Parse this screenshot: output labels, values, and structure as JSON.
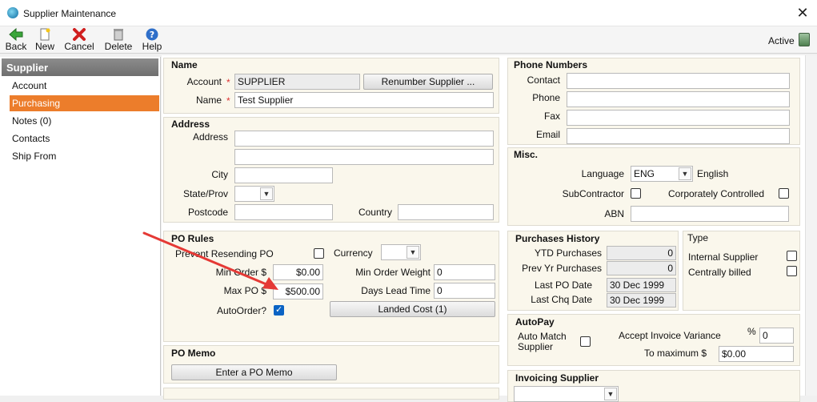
{
  "window": {
    "title": "Supplier Maintenance",
    "close_glyph": "✕"
  },
  "toolbar": {
    "back": "Back",
    "new": "New",
    "cancel": "Cancel",
    "delete": "Delete",
    "help": "Help",
    "status": "Active"
  },
  "sidebar": {
    "header": "Supplier",
    "items": [
      {
        "label": "Account"
      },
      {
        "label": "Purchasing"
      },
      {
        "label": "Notes (0)"
      },
      {
        "label": "Contacts"
      },
      {
        "label": "Ship From"
      }
    ]
  },
  "name_group": {
    "title": "Name",
    "account_label": "Account",
    "account_value": "SUPPLIER",
    "renumber_button": "Renumber Supplier ...",
    "name_label": "Name",
    "name_value": "Test Supplier",
    "required_mark": "*"
  },
  "address_group": {
    "title": "Address",
    "address_label": "Address",
    "address1": "",
    "address2": "",
    "city_label": "City",
    "city": "",
    "state_label": "State/Prov",
    "state": "",
    "postcode_label": "Postcode",
    "postcode": "",
    "country_label": "Country",
    "country": ""
  },
  "phone_group": {
    "title": "Phone Numbers",
    "contact_label": "Contact",
    "contact": "",
    "phone_label": "Phone",
    "phone": "",
    "fax_label": "Fax",
    "fax": "",
    "email_label": "Email",
    "email": ""
  },
  "misc_group": {
    "title": "Misc.",
    "language_label": "Language",
    "language_code": "ENG",
    "language_name": "English",
    "subcontractor_label": "SubContractor",
    "corporately_label": "Corporately Controlled",
    "abn_label": "ABN",
    "abn": ""
  },
  "po_rules": {
    "title": "PO Rules",
    "prevent_label": "Prevent Resending PO",
    "currency_label": "Currency",
    "currency": "",
    "min_order_label": "Min Order $",
    "min_order": "$0.00",
    "min_weight_label": "Min Order Weight",
    "min_weight": "0",
    "max_po_label": "Max PO $",
    "max_po": "$500.00",
    "lead_time_label": "Days Lead Time",
    "lead_time": "0",
    "autoorder_label": "AutoOrder?",
    "landed_cost_button": "Landed Cost (1)"
  },
  "purchases_history": {
    "title": "Purchases History",
    "ytd_label": "YTD Purchases",
    "ytd": "0",
    "prev_label": "Prev Yr Purchases",
    "prev": "0",
    "last_po_label": "Last PO Date",
    "last_po": "30 Dec 1999",
    "last_chq_label": "Last Chq Date",
    "last_chq": "30 Dec 1999"
  },
  "type_group": {
    "title": "Type",
    "internal_label": "Internal Supplier",
    "centrally_label": "Centrally billed"
  },
  "autopay": {
    "title": "AutoPay",
    "auto_match_label": "Auto Match Supplier",
    "accept_variance_label": "Accept Invoice Variance",
    "percent_label": "%",
    "variance": "0",
    "to_max_label": "To maximum $",
    "to_max": "$0.00"
  },
  "po_memo": {
    "title": "PO Memo",
    "button": "Enter a PO Memo"
  },
  "invoicing_supplier": {
    "title": "Invoicing Supplier",
    "value": ""
  },
  "colors": {
    "accent": "#ec7d2b",
    "group_bg": "#faf7ec",
    "arrow": "#e53935"
  }
}
